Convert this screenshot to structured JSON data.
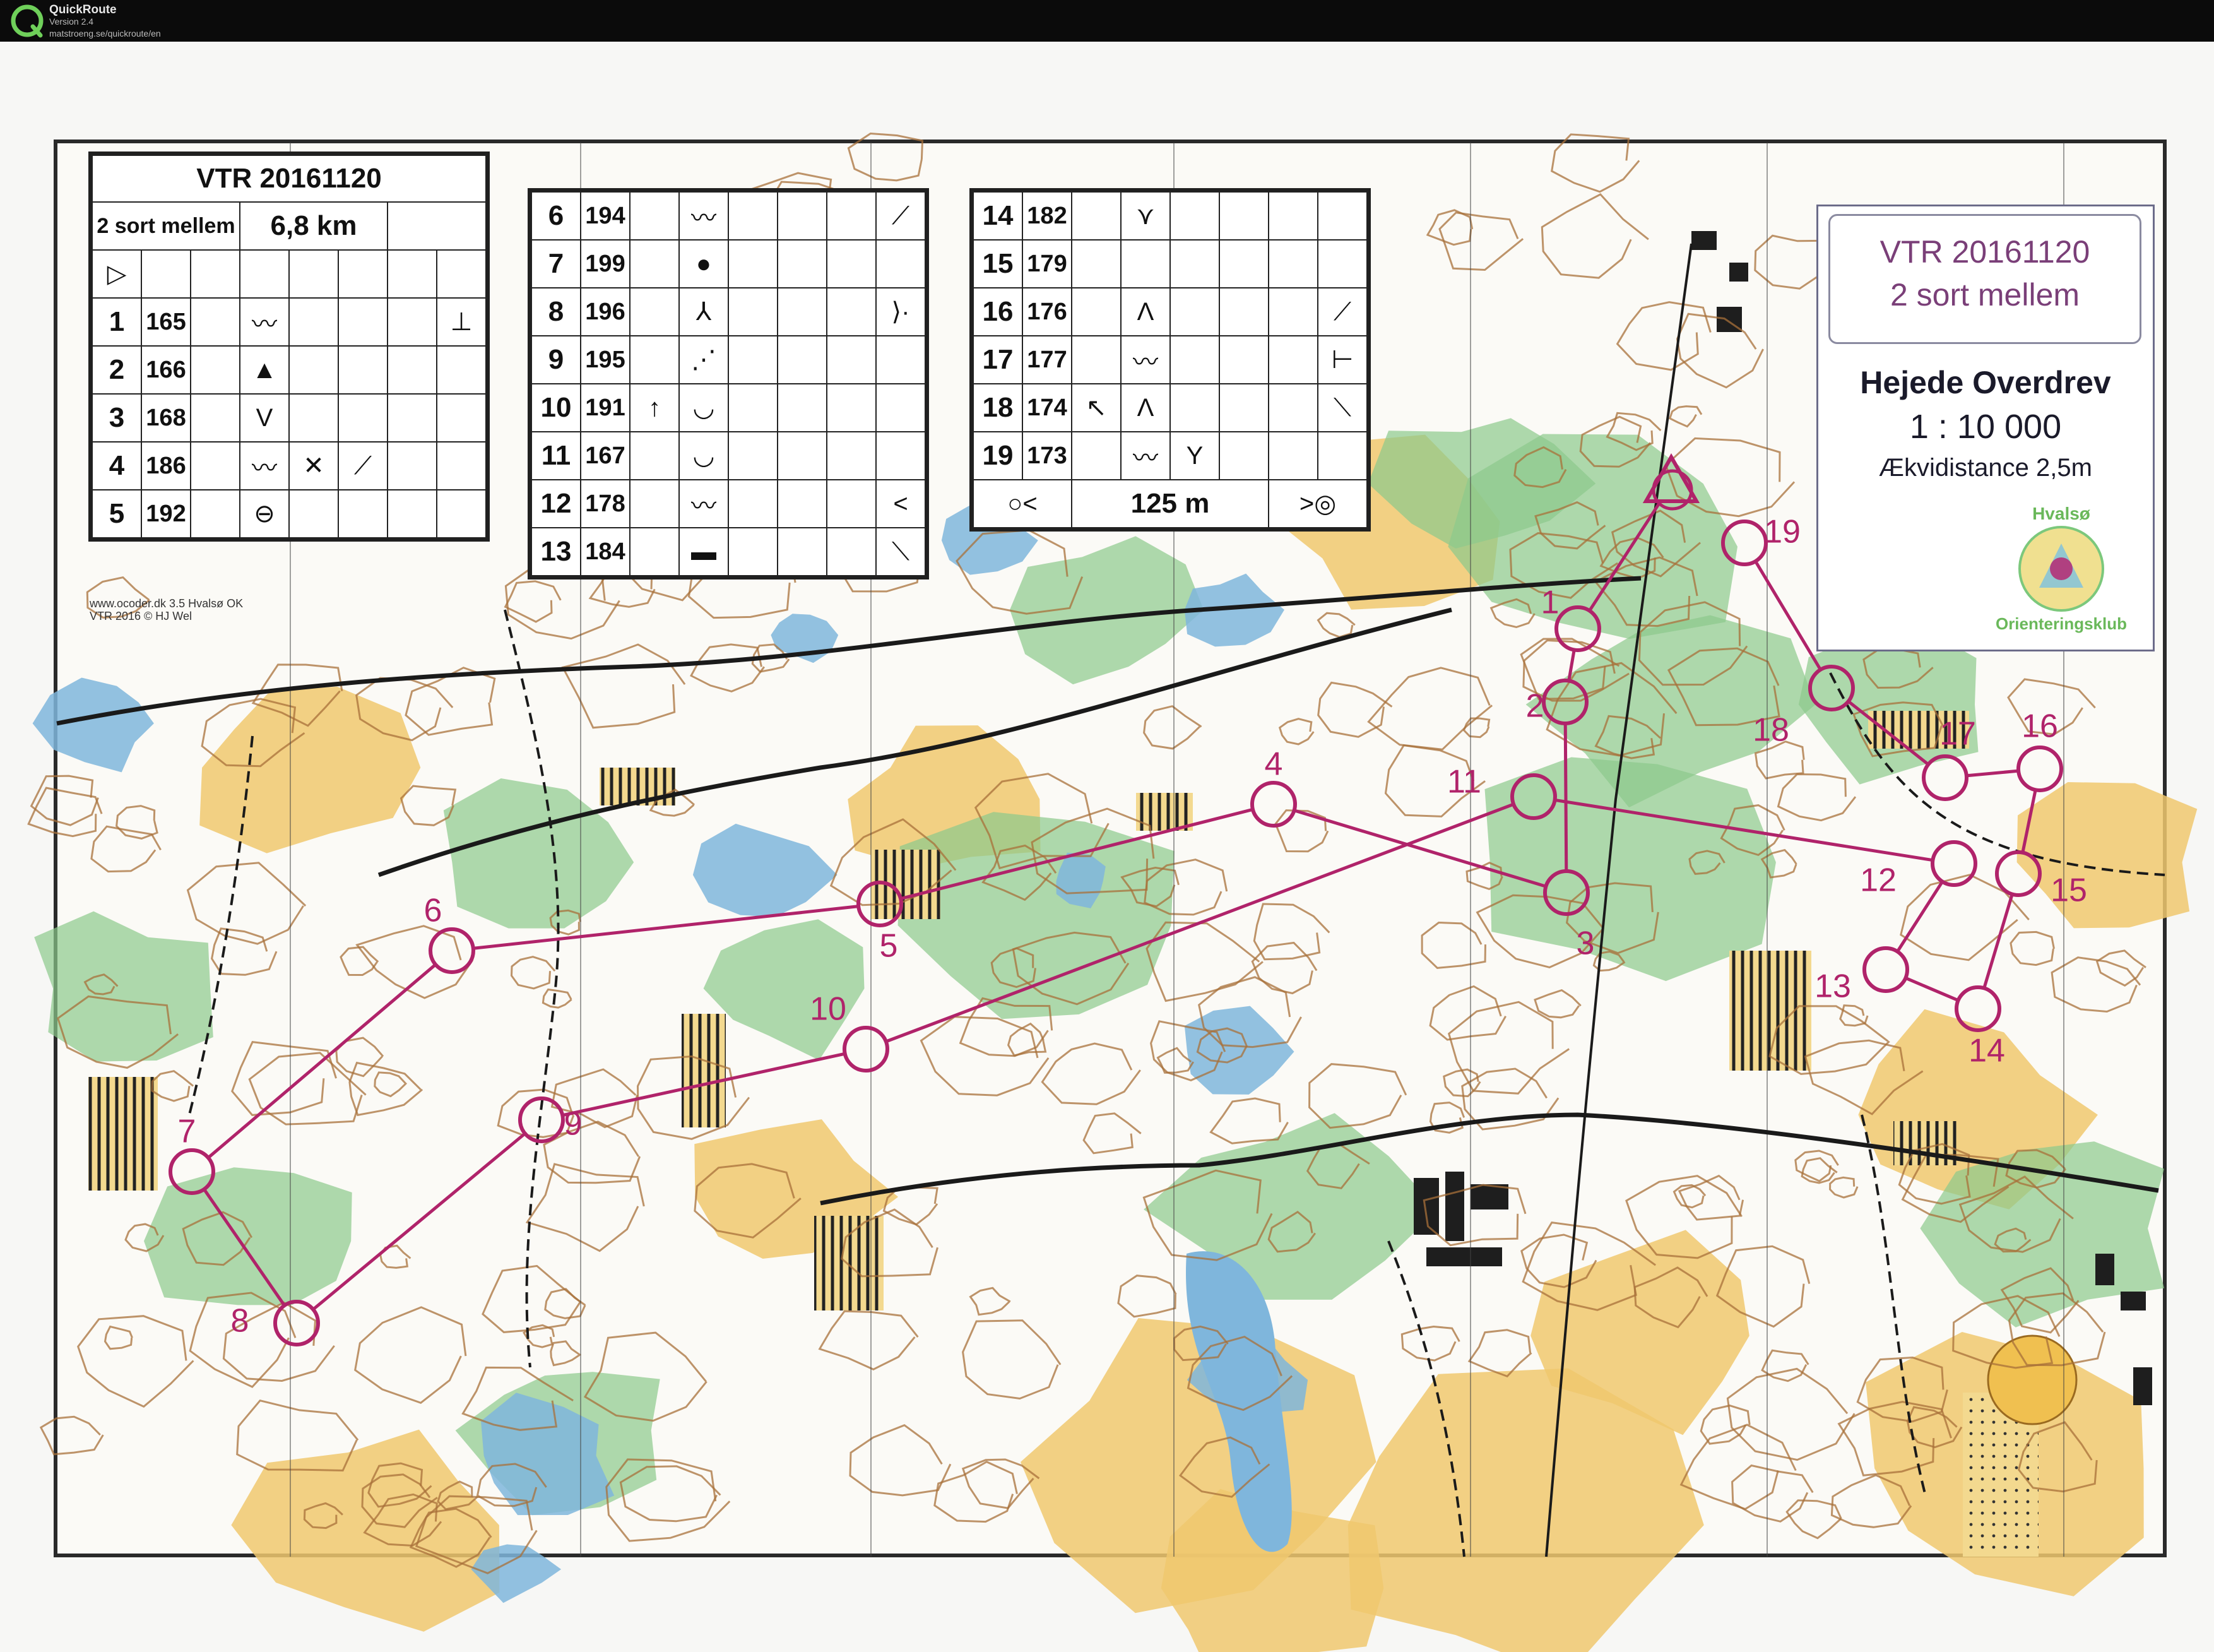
{
  "window": {
    "app_name": "QuickRoute",
    "version": "Version 2.4",
    "url": "matstroeng.se/quickroute/en"
  },
  "course": {
    "event": "VTR 20161120",
    "class": "2 sort mellem",
    "length": "6,8 km",
    "finish_distance": "125 m",
    "controls": [
      {
        "n": "1",
        "code": "165",
        "cols": [
          "",
          "",
          "〰",
          "",
          "",
          "",
          "⊥"
        ]
      },
      {
        "n": "2",
        "code": "166",
        "cols": [
          "",
          "",
          "▲",
          "",
          "",
          "",
          ""
        ]
      },
      {
        "n": "3",
        "code": "168",
        "cols": [
          "",
          "",
          "V",
          "",
          "",
          "",
          ""
        ]
      },
      {
        "n": "4",
        "code": "186",
        "cols": [
          "",
          "",
          "〰",
          "✕",
          "⟋",
          "",
          ""
        ]
      },
      {
        "n": "5",
        "code": "192",
        "cols": [
          "",
          "",
          "⊖",
          "",
          "",
          "",
          ""
        ]
      },
      {
        "n": "6",
        "code": "194",
        "cols": [
          "",
          "",
          "〰",
          "",
          "",
          "",
          "⟋"
        ]
      },
      {
        "n": "7",
        "code": "199",
        "cols": [
          "",
          "",
          "●",
          "",
          "",
          "",
          ""
        ]
      },
      {
        "n": "8",
        "code": "196",
        "cols": [
          "",
          "",
          "⅄",
          "",
          "",
          "",
          "⟩·"
        ]
      },
      {
        "n": "9",
        "code": "195",
        "cols": [
          "",
          "",
          "⋰",
          "",
          "",
          "",
          ""
        ]
      },
      {
        "n": "10",
        "code": "191",
        "cols": [
          "",
          "↑",
          "◡",
          "",
          "",
          "",
          ""
        ]
      },
      {
        "n": "11",
        "code": "167",
        "cols": [
          "",
          "",
          "◡",
          "",
          "",
          "",
          ""
        ]
      },
      {
        "n": "12",
        "code": "178",
        "cols": [
          "",
          "",
          "〰",
          "",
          "",
          "",
          "<"
        ]
      },
      {
        "n": "13",
        "code": "184",
        "cols": [
          "",
          "",
          "▬",
          "",
          "",
          "",
          "⟍"
        ]
      },
      {
        "n": "14",
        "code": "182",
        "cols": [
          "",
          "",
          "⋎",
          "",
          "",
          "",
          ""
        ]
      },
      {
        "n": "15",
        "code": "179",
        "cols": [
          "",
          "",
          "",
          "",
          "",
          "",
          ""
        ]
      },
      {
        "n": "16",
        "code": "176",
        "cols": [
          "",
          "",
          "Λ",
          "",
          "",
          "",
          "⟋"
        ]
      },
      {
        "n": "17",
        "code": "177",
        "cols": [
          "",
          "",
          "〰",
          "",
          "",
          "",
          "⊢"
        ]
      },
      {
        "n": "18",
        "code": "174",
        "cols": [
          "",
          "↖",
          "Λ",
          "",
          "",
          "",
          "⟍"
        ]
      },
      {
        "n": "19",
        "code": "173",
        "cols": [
          "",
          "",
          "〰",
          "Y",
          "",
          "",
          ""
        ]
      }
    ]
  },
  "legend": {
    "event": "VTR 20161120",
    "class": "2 sort mellem",
    "map_name": "Hejede Overdrev",
    "scale": "1 : 10 000",
    "contour": "Ækvidistance 2,5m",
    "club_top": "Hvalsø",
    "club_bottom": "Orienteringsklub"
  },
  "copyright": {
    "line1": "www.ocoder.dk 3.5 Hvalsø OK",
    "line2": "VTR 2016 © HJ Wel"
  },
  "map": {
    "colors": {
      "course": "#b0236a",
      "open_land": "#f0c86e",
      "forest": "#ffffff",
      "green": "#8cc98c",
      "water": "#7fb6dc",
      "contour": "#a8703a",
      "paper": "#f7f7f5"
    },
    "control_labels": [
      "1",
      "2",
      "3",
      "4",
      "5",
      "6",
      "7",
      "8",
      "9",
      "10",
      "11",
      "12",
      "13",
      "14",
      "15",
      "16",
      "17",
      "18",
      "19"
    ]
  }
}
